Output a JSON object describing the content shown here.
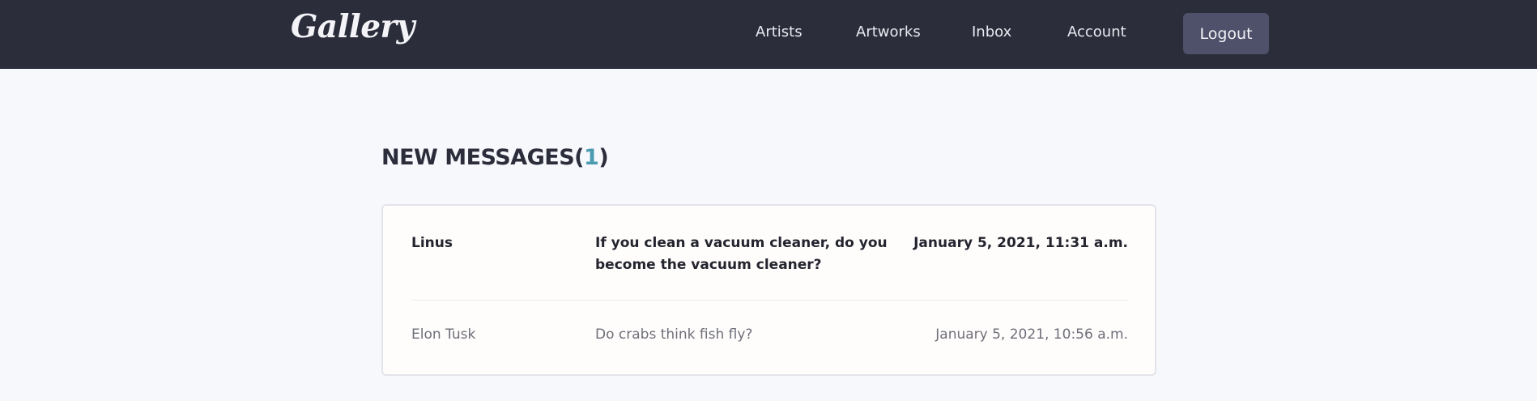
{
  "nav": {
    "logo": "Gallery",
    "links": [
      "Artists",
      "Artworks",
      "Inbox",
      "Account"
    ],
    "logout_label": "Logout"
  },
  "main": {
    "title": "NEW MESSAGES",
    "title_open": "(",
    "new_count": "1",
    "title_close": ")",
    "messages": [
      {
        "sender": "Linus",
        "subject": "If you clean a vacuum cleaner, do you become the vacuum cleaner?",
        "date": "January 5, 2021, 11:31 a.m.",
        "unread": true
      },
      {
        "sender": "Elon Tusk",
        "subject": "Do crabs think fish fly?",
        "date": "January 5, 2021, 10:56 a.m.",
        "unread": false
      }
    ]
  },
  "colors": {
    "navbar_bg": "#2c2d3b",
    "page_bg": "#f7f8fc",
    "accent": "#4a9bb0",
    "logout_bg": "#4f5069"
  }
}
